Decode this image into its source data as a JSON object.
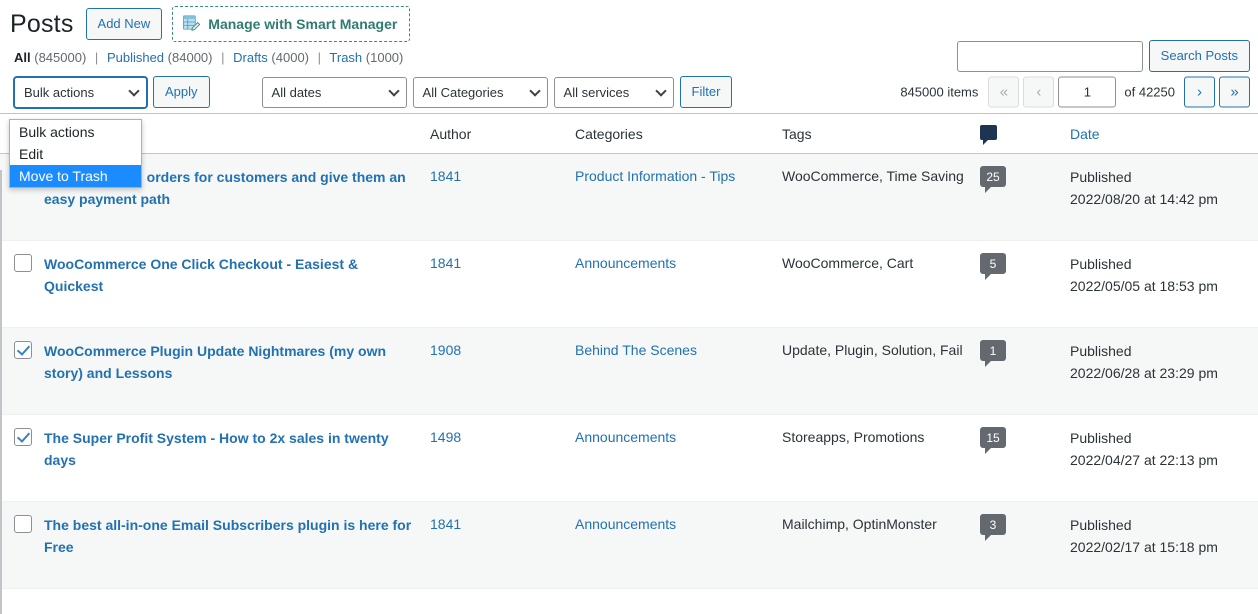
{
  "header": {
    "title": "Posts",
    "add_new_label": "Add New",
    "smart_manager_label": "Manage with Smart Manager",
    "smart_manager_icon": "spreadsheet-edit-icon"
  },
  "status_links": [
    {
      "label": "All",
      "count": "(845000)",
      "current": true
    },
    {
      "label": "Published",
      "count": "(84000)",
      "current": false
    },
    {
      "label": "Drafts",
      "count": "(4000)",
      "current": false
    },
    {
      "label": "Trash",
      "count": "(1000)",
      "current": false
    }
  ],
  "search": {
    "value": "",
    "placeholder": "",
    "button_label": "Search Posts"
  },
  "toolbar": {
    "bulk_actions_value": "Bulk actions",
    "bulk_actions_options": [
      "Bulk actions",
      "Edit",
      "Move to Trash"
    ],
    "bulk_actions_selected_option": "Move to Trash",
    "apply_label": "Apply",
    "dates_value": "All dates",
    "categories_value": "All Categories",
    "services_value": "All services",
    "filter_label": "Filter"
  },
  "pagination": {
    "items_label": "845000 items",
    "first_label": "«",
    "prev_label": "‹",
    "current_page": "1",
    "of_label": "of 42250",
    "next_label": "›",
    "last_label": "»"
  },
  "table": {
    "columns": {
      "title": "",
      "author": "Author",
      "categories": "Categories",
      "tags": "Tags",
      "comments": "comment-bubble-icon",
      "date": "Date"
    },
    "rows": [
      {
        "checked": false,
        "title": "Quick Tip: Add orders for customers and give them an easy payment path",
        "author": "1841",
        "category": "Product Information - Tips",
        "tags": "WooCommerce, Time Saving",
        "comments": "25",
        "status": "Published",
        "date": "2022/08/20 at 14:42 pm"
      },
      {
        "checked": false,
        "title": "WooCommerce One Click Checkout - Easiest & Quickest",
        "author": "1841",
        "category": "Announcements",
        "tags": "WooCommerce, Cart",
        "comments": "5",
        "status": "Published",
        "date": "2022/05/05 at 18:53 pm"
      },
      {
        "checked": true,
        "title": "WooCommerce Plugin Update Nightmares (my own story) and Lessons",
        "author": "1908",
        "category": "Behind The Scenes",
        "tags": "Update, Plugin, Solution, Fail",
        "comments": "1",
        "status": "Published",
        "date": "2022/06/28 at 23:29 pm"
      },
      {
        "checked": true,
        "title": "The Super Profit System - How to 2x sales in twenty days",
        "author": "1498",
        "category": "Announcements",
        "tags": "Storeapps, Promotions",
        "comments": "15",
        "status": "Published",
        "date": "2022/04/27 at 22:13 pm"
      },
      {
        "checked": false,
        "title": "The best all-in-one Email Subscribers plugin is here for Free",
        "author": "1841",
        "category": "Announcements",
        "tags": "Mailchimp, OptinMonster",
        "comments": "3",
        "status": "Published",
        "date": "2022/02/17 at 15:18 pm"
      }
    ]
  },
  "colors": {
    "link": "#2271b1",
    "highlight": "#1a8cff",
    "smart_manager": "#2e7d6f",
    "row_alt": "#f6f7f7",
    "bubble": "#646970"
  }
}
